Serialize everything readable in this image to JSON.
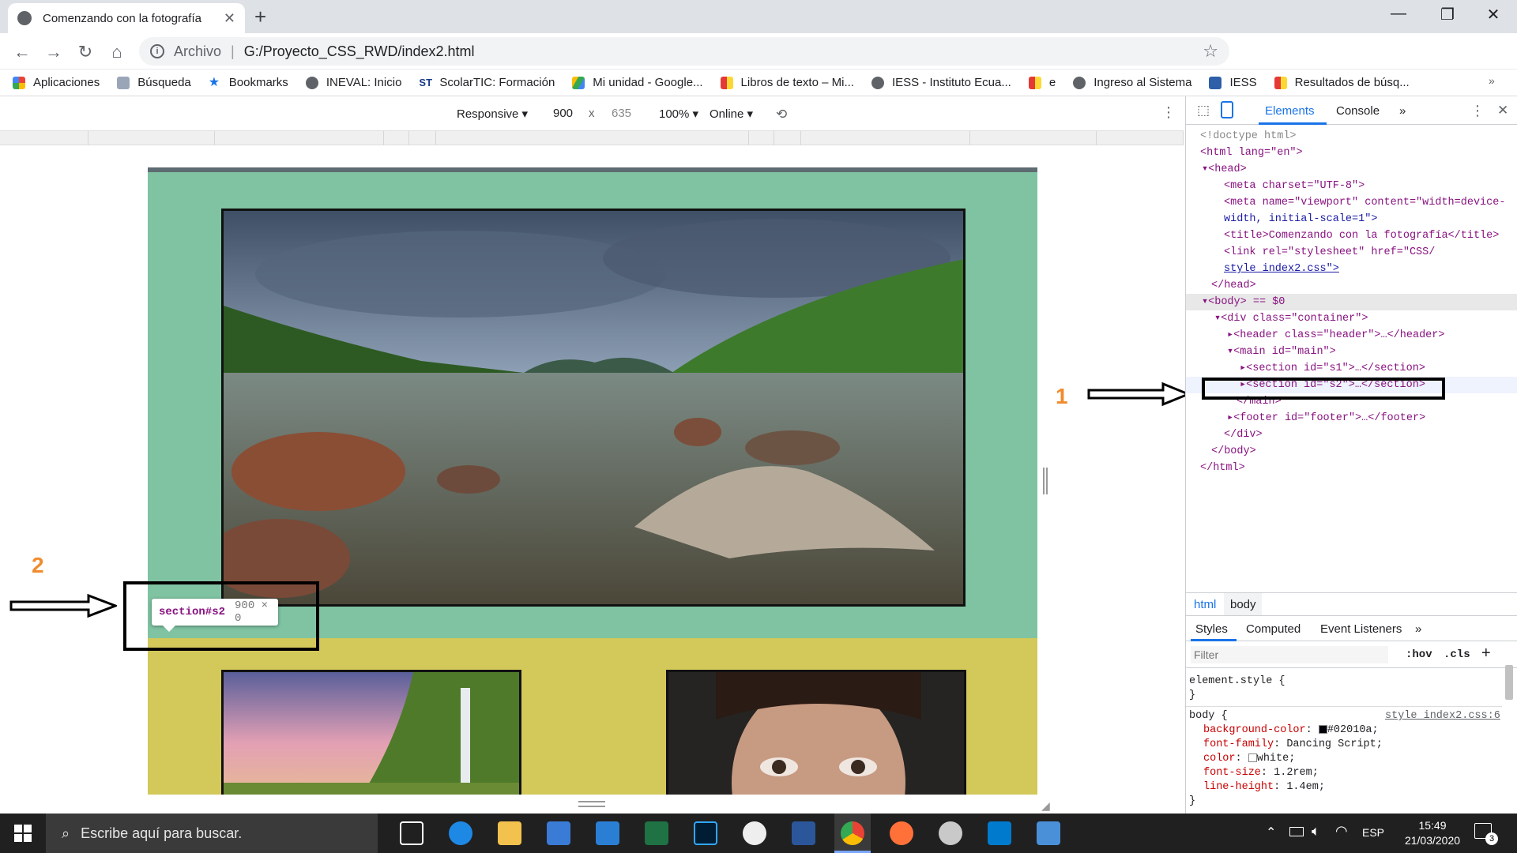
{
  "browser": {
    "tab_title": "Comenzando con la fotografía",
    "url_label": "Archivo",
    "url_path": "G:/Proyecto_CSS_RWD/index2.html",
    "bookmarks": [
      "Aplicaciones",
      "Búsqueda",
      "Bookmarks",
      "INEVAL: Inicio",
      "ScolarTIC: Formación",
      "Mi unidad - Google...",
      "Libros de texto – Mi...",
      "IESS - Instituto Ecua...",
      "e",
      "Ingreso al Sistema",
      "IESS",
      "Resultados de búsq..."
    ],
    "bookmarks_more": "»"
  },
  "device_toolbar": {
    "mode": "Responsive ▾",
    "width": "900",
    "x": "x",
    "height": "635",
    "zoom": "100%  ▾",
    "network": "Online  ▾"
  },
  "tooltip": {
    "selector": "section#s2",
    "size": "900 × 0"
  },
  "annotations": {
    "one": "1",
    "two": "2"
  },
  "devtools": {
    "tabs": [
      "Elements",
      "Console",
      "»"
    ],
    "tree": {
      "doctype": "<!doctype html>",
      "html_open": "<html lang=\"en\">",
      "head_open": "▾<head>",
      "meta_charset": "<meta charset=\"UTF-8\">",
      "meta_viewport_1": "<meta name=\"viewport\" content=\"width=device-",
      "meta_viewport_2": "width, initial-scale=1\">",
      "title": "<title>Comenzando con la fotografía</title>",
      "link_1": "<link rel=\"stylesheet\" href=\"CSS/",
      "link_2": "style_index2.css\">",
      "head_close": "</head>",
      "body_open": "▾<body> == $0",
      "div_open": "▾<div class=\"container\">",
      "header": "▸<header class=\"header\">…</header>",
      "main_open": "▾<main id=\"main\">",
      "s1": "▸<section id=\"s1\">…</section>",
      "s2": "▸<section id=\"s2\">…</section>",
      "main_close": "</main>",
      "footer": "▸<footer id=\"footer\">…</footer>",
      "div_close": "</div>",
      "body_close": "</body>",
      "html_close": "</html>"
    },
    "breadcrumbs": [
      "html",
      "body"
    ],
    "styles_tabs": [
      "Styles",
      "Computed",
      "Event Listeners",
      "»"
    ],
    "filter_placeholder": "Filter",
    "hov": ":hov",
    "cls": ".cls",
    "plus": "+",
    "element_style": "element.style {",
    "close_brace": "}",
    "body_rule": "body {",
    "rule_source": "style_index2.css:6",
    "declarations": [
      {
        "prop": "background-color",
        "val": "#02010a;"
      },
      {
        "prop": "font-family",
        "val": "Dancing Script;"
      },
      {
        "prop": "color",
        "val": "white;"
      },
      {
        "prop": "font-size",
        "val": "1.2rem;"
      },
      {
        "prop": "line-height",
        "val": "1.4em;"
      }
    ]
  },
  "taskbar": {
    "search_placeholder": "Escribe aquí para buscar.",
    "lang": "ESP",
    "time": "15:49",
    "date": "21/03/2020",
    "notif": "3"
  },
  "colors": {
    "page_s1": "#7fc3a2",
    "page_s2": "#d3c85a",
    "swatch": "#02010a",
    "accent": "#f08c2e"
  }
}
